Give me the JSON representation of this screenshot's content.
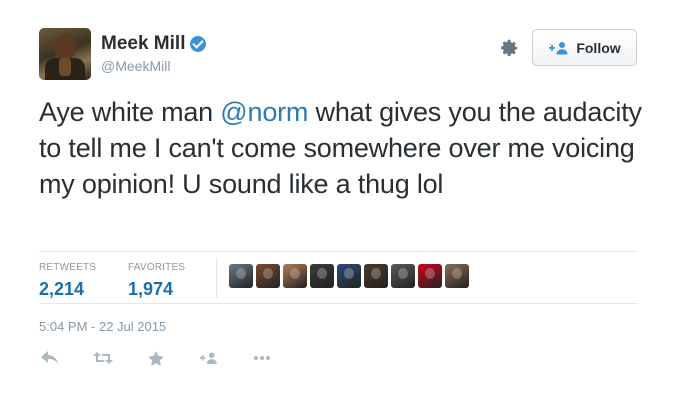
{
  "tweet": {
    "author": {
      "display_name": "Meek Mill",
      "handle": "@MeekMill",
      "verified": true
    },
    "text_parts": {
      "before": "Aye white man ",
      "mention": "@norm",
      "after": " what gives you the audacity to tell me I can't come somewhere over me voicing my opinion! U sound like a thug lol"
    },
    "stats": {
      "retweets_label": "RETWEETS",
      "retweets_value": "2,214",
      "favorites_label": "FAVORITES",
      "favorites_value": "1,974"
    },
    "timestamp": "5:04 PM - 22 Jul 2015"
  },
  "header": {
    "follow_label": "Follow",
    "settings_icon": "gear-icon"
  },
  "favoriters": [
    {
      "name": "favoriter-avatar-1",
      "color": "#6c7a86"
    },
    {
      "name": "favoriter-avatar-2",
      "color": "#7a4a2e"
    },
    {
      "name": "favoriter-avatar-3",
      "color": "#b67a5a"
    },
    {
      "name": "favoriter-avatar-4",
      "color": "#3a3a3a"
    },
    {
      "name": "favoriter-avatar-5",
      "color": "#2e4b7a"
    },
    {
      "name": "favoriter-avatar-6",
      "color": "#4d3a2a"
    },
    {
      "name": "favoriter-avatar-7",
      "color": "#5a5a5a"
    },
    {
      "name": "favoriter-avatar-8",
      "color": "#d0021b"
    },
    {
      "name": "favoriter-avatar-9",
      "color": "#8a6d55"
    }
  ],
  "actions": [
    "reply-icon",
    "retweet-icon",
    "favorite-icon",
    "follow-icon",
    "more-icon"
  ],
  "colors": {
    "accent": "#2b7bb9",
    "stat_value": "#1b6fae",
    "muted": "#8899a6",
    "text": "#292f33"
  }
}
